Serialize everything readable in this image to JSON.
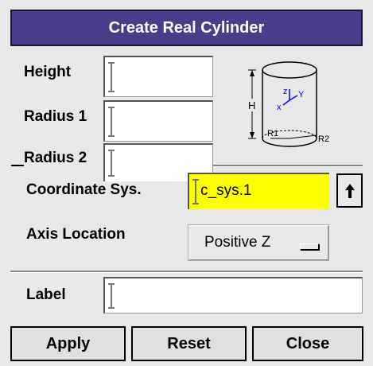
{
  "dialog": {
    "title": "Create Real Cylinder",
    "fields": {
      "height": {
        "label": "Height",
        "value": ""
      },
      "radius1": {
        "label": "Radius 1",
        "value": ""
      },
      "radius2": {
        "label": "Radius 2",
        "value": ""
      }
    },
    "coordinate_sys": {
      "label": "Coordinate Sys.",
      "value": "c_sys.1"
    },
    "axis_location": {
      "label": "Axis Location",
      "value": "Positive Z"
    },
    "label_field": {
      "label": "Label",
      "value": ""
    },
    "diagram": {
      "h": "H",
      "z": "z",
      "y": "Y",
      "x": "x",
      "r1": "R1",
      "r2": "R2"
    },
    "buttons": {
      "apply": "Apply",
      "reset": "Reset",
      "close": "Close"
    }
  },
  "colors": {
    "title_bar": "#4a3d8c",
    "highlight": "#ffff00"
  },
  "icons": [
    "text-cursor-icon",
    "up-arrow-icon",
    "option-menu-bar-icon"
  ]
}
